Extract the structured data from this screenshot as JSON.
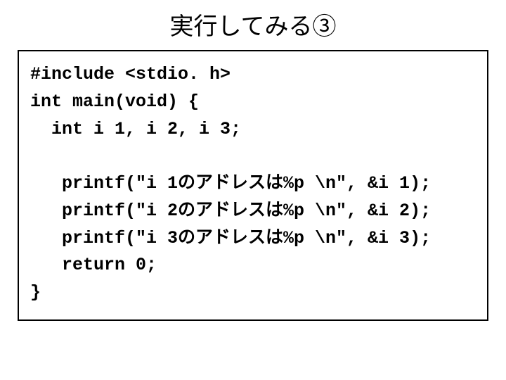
{
  "title": "実行してみる③",
  "code": {
    "line1": "#include <stdio. h>",
    "line2": "int main(void) {",
    "line3": "  int i 1, i 2, i 3;",
    "line4": "   printf(\"i 1のアドレスは%p \\n\", &i 1);",
    "line5": "   printf(\"i 2のアドレスは%p \\n\", &i 2);",
    "line6": "   printf(\"i 3のアドレスは%p \\n\", &i 3);",
    "line7": "   return 0;",
    "line8": "}"
  }
}
